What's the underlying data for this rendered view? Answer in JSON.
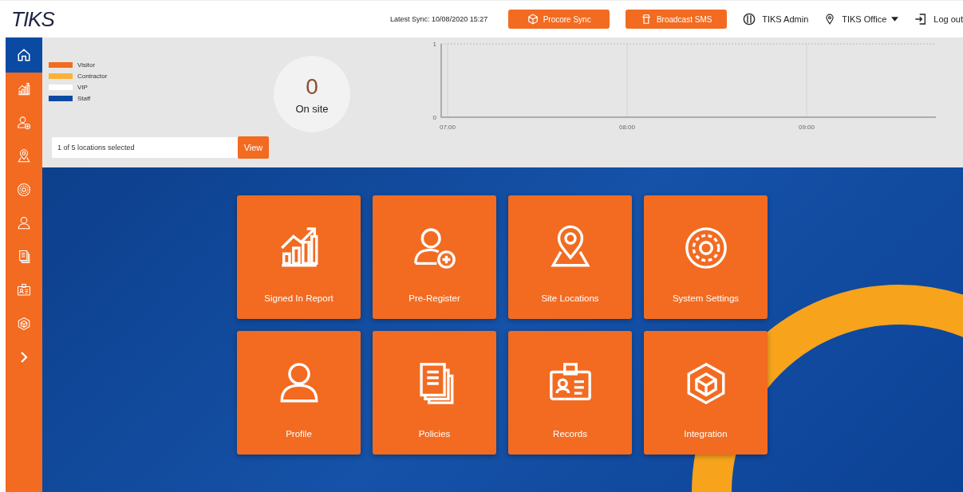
{
  "header": {
    "logo": "TIKS",
    "sync": "Latest Sync: 10/08/2020 15:27",
    "buttons": [
      {
        "label": "Procore Sync",
        "kind": "sync"
      },
      {
        "label": "Broadcast SMS",
        "kind": "sms"
      }
    ],
    "user": "TIKS Admin",
    "office": "TIKS Office",
    "logout": "Log out"
  },
  "sidebar": {
    "items": [
      {
        "kind": "home",
        "selected": true
      },
      {
        "kind": "report",
        "selected": false
      },
      {
        "kind": "register",
        "selected": false
      },
      {
        "kind": "locations",
        "selected": false
      },
      {
        "kind": "settings",
        "selected": false
      },
      {
        "kind": "profile",
        "selected": false
      },
      {
        "kind": "policies",
        "selected": false
      },
      {
        "kind": "records",
        "selected": false
      },
      {
        "kind": "integration",
        "selected": false
      },
      {
        "kind": "expand",
        "selected": false
      }
    ]
  },
  "legend": [
    {
      "label": "Visitor",
      "color": "#f26b21"
    },
    {
      "label": "Contractor",
      "color": "#fbb03b"
    },
    {
      "label": "VIP",
      "color": "#ffffff"
    },
    {
      "label": "Staff",
      "color": "#0b4aa2"
    }
  ],
  "on_site": {
    "count": "0",
    "label": "On site"
  },
  "locations": {
    "value": "1 of 5 locations selected",
    "button": "View"
  },
  "chart": {
    "chart_data": {
      "type": "line",
      "x": [
        "07:00",
        "08:00",
        "09:00"
      ],
      "ylim": [
        0,
        1
      ],
      "yticks": [
        0,
        1
      ],
      "grid": true
    }
  },
  "tiles": [
    {
      "label": "Signed In Report",
      "kind": "report"
    },
    {
      "label": "Pre-Register",
      "kind": "register"
    },
    {
      "label": "Site Locations",
      "kind": "locations"
    },
    {
      "label": "System Settings",
      "kind": "settings"
    },
    {
      "label": "Profile",
      "kind": "profile"
    },
    {
      "label": "Policies",
      "kind": "policies"
    },
    {
      "label": "Records",
      "kind": "records"
    },
    {
      "label": "Integration",
      "kind": "integration"
    }
  ]
}
